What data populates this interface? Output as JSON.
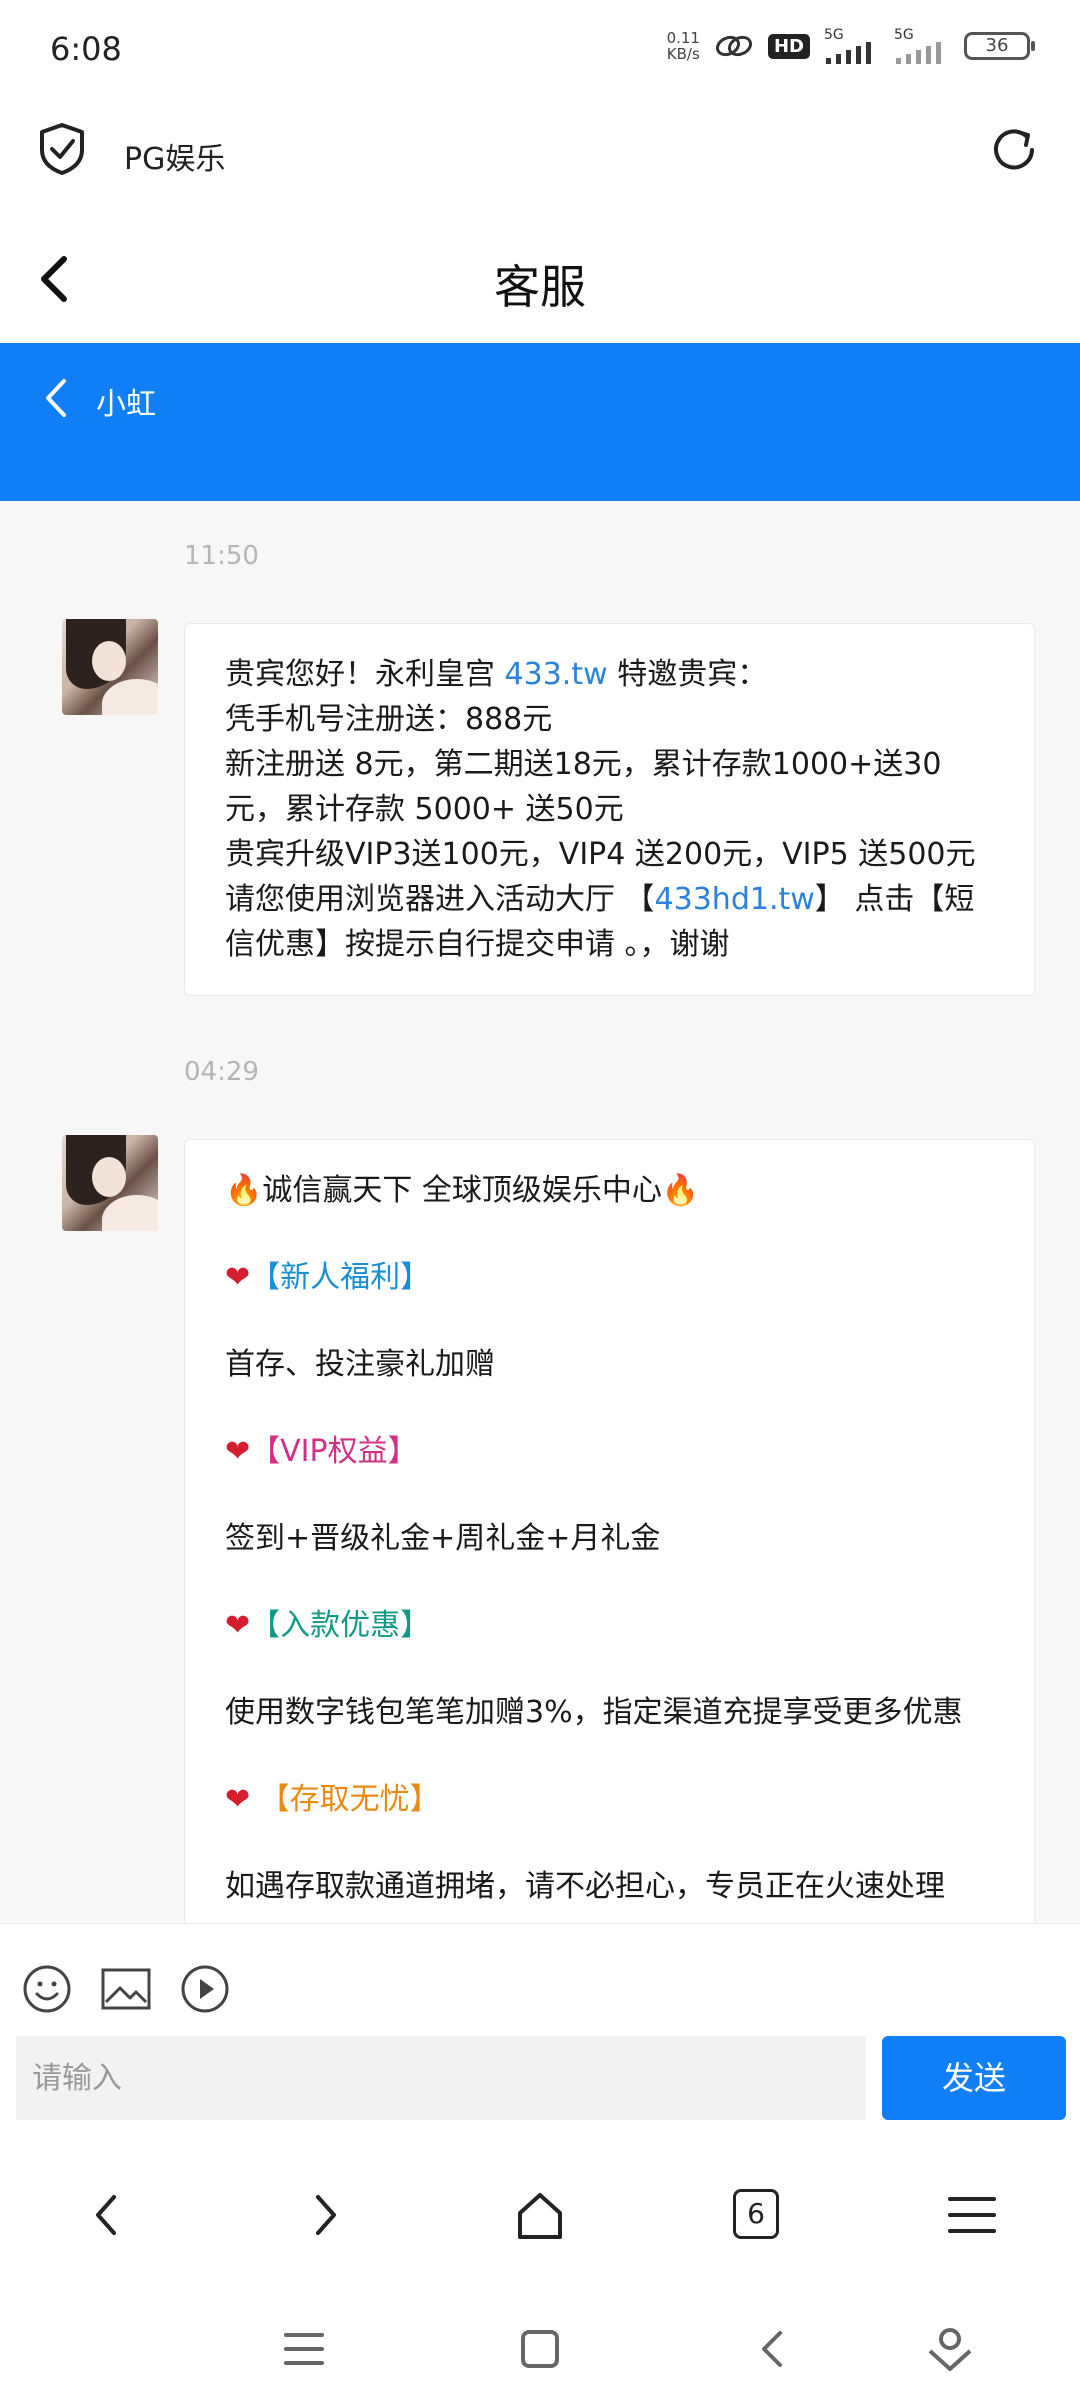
{
  "status": {
    "time": "6:08",
    "net_speed_value": "0.11",
    "net_speed_unit": "KB/s",
    "hd_badge": "HD",
    "signal1": "5G",
    "signal2": "5G",
    "battery": "36"
  },
  "browser": {
    "site_name": "PG娱乐"
  },
  "page": {
    "title": "客服"
  },
  "agent": {
    "name": "小虹"
  },
  "messages": [
    {
      "time": "11:50",
      "line1_prefix": "贵宾您好！永利皇宫 ",
      "line1_link": "433.tw",
      "line1_suffix": " 特邀贵宾：",
      "line2": "凭手机号注册送：888元",
      "line3": "新注册送 8元，第二期送18元，累计存款1000+送30元，累计存款 5000+ 送50元",
      "line4": "贵宾升级VIP3送100元，VIP4 送200元，VIP5 送500元",
      "line5_prefix": "请您使用浏览器进入活动大厅 【",
      "line5_link": "433hd1.tw",
      "line5_suffix": "】 点击【短信优惠】按提示自行提交申请 。，谢谢"
    },
    {
      "time": "04:29",
      "headline_fire_left": "🔥",
      "headline": "诚信赢天下 全球顶级娱乐中心",
      "headline_fire_right": "🔥",
      "heart": "❤",
      "section1_title": "【新人福利】",
      "section1_text": "首存、投注豪礼加赠",
      "section2_title": "【VIP权益】",
      "section2_text": "签到+晋级礼金+周礼金+月礼金",
      "section3_title": "【入款优惠】",
      "section3_text": "使用数字钱包笔笔加赠3%，指定渠道充提享受更多优惠",
      "section4_title": " 【存取无忧】",
      "section4_text": "如遇存取款通道拥堵，请不必担心，专员正在火速处理"
    }
  ],
  "input": {
    "placeholder": "请输入",
    "send_label": "发送"
  },
  "toolbar": {
    "tab_count": "6"
  },
  "icons": {
    "shield": "shield-check-icon",
    "refresh": "refresh-icon",
    "back": "chevron-left-icon",
    "emoji": "emoji-icon",
    "image": "image-icon",
    "video": "play-icon",
    "forward": "chevron-right-icon",
    "home": "home-icon",
    "menu": "menu-icon",
    "sys_back": "system-back-icon",
    "sys_home": "system-home-icon",
    "sys_menu": "system-menu-icon",
    "assistant": "assistant-icon"
  },
  "colors": {
    "accent": "#1180f8",
    "link": "#2a83d8",
    "heart": "#d41e2d"
  }
}
